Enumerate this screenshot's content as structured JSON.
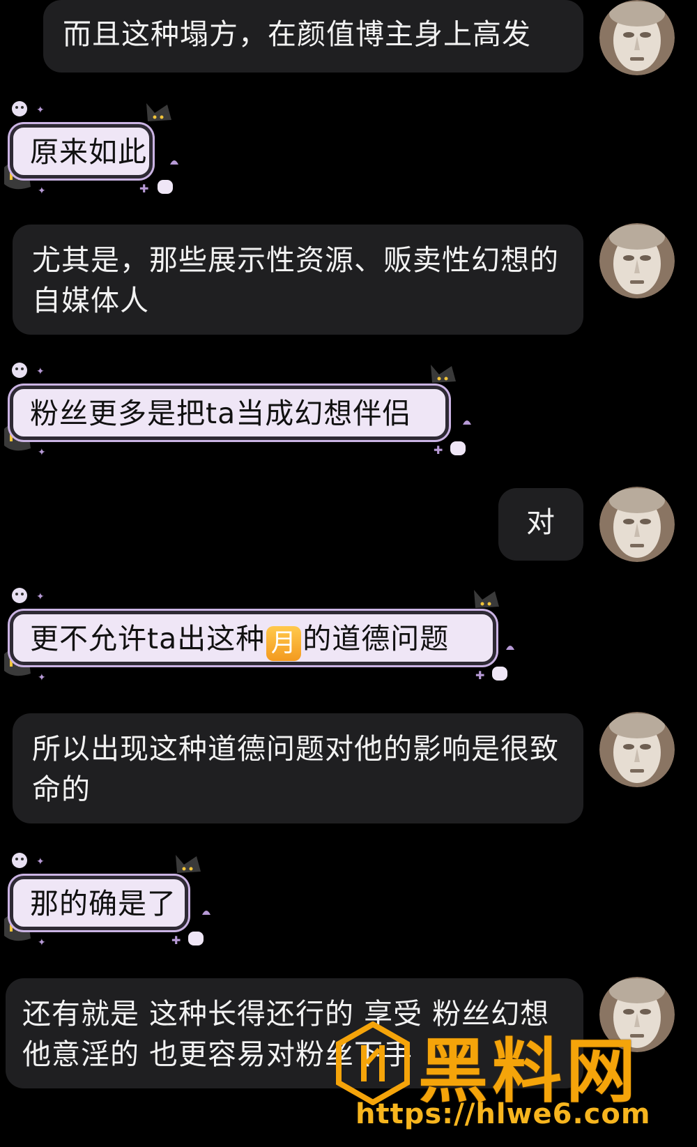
{
  "messages": [
    {
      "side": "right",
      "text": "而且这种塌方，在颜值博主身上高发"
    },
    {
      "side": "left",
      "text": "原来如此"
    },
    {
      "side": "right",
      "text": "尤其是，那些展示性资源、贩卖性幻想的自媒体人"
    },
    {
      "side": "left",
      "text": "粉丝更多是把ta当成幻想伴侣"
    },
    {
      "side": "right",
      "text": "对"
    },
    {
      "side": "left",
      "text_before": "更不允许ta出这种",
      "emoji": "月",
      "text_after": "的道德问题"
    },
    {
      "side": "right",
      "text": "所以出现这种道德问题对他的影响是很致命的"
    },
    {
      "side": "left",
      "text": "那的确是了"
    },
    {
      "side": "right",
      "text": "还有就是 这种长得还行的 享受 粉丝幻想 他意淫的 也更容易对粉丝下手"
    }
  ],
  "watermark": {
    "title": "黑料网",
    "url": "https://hlwe6.com"
  },
  "colors": {
    "background": "#000000",
    "dark_bubble": "#1f1f21",
    "light_bubble": "#efe6f6",
    "light_bubble_glow": "#cbb4e4",
    "watermark": "#f5a40a"
  },
  "icons": {
    "avatar": "marble-statue-avatar",
    "bubble_decor": "ghost-cat-sticker-decor",
    "emoji": "moon-emoji"
  }
}
